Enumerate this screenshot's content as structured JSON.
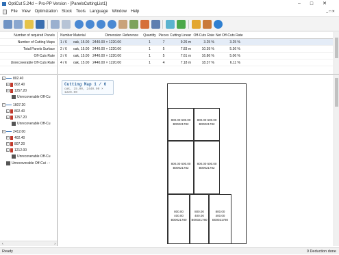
{
  "window": {
    "title": "OptiCut 5.24d -- Pro-PP Version - [PanelsCuttingList1]",
    "buttons": [
      "–",
      "□",
      "✕"
    ]
  },
  "menu": {
    "items": [
      "File",
      "View",
      "Optimization",
      "Stock",
      "Tools",
      "Language",
      "Window",
      "Help"
    ],
    "mdi_controls": "_ □ ✕"
  },
  "toolbar": {
    "icons": [
      "grid-icon",
      "list-icon",
      "new-icon",
      "save-icon",
      "calc-icon",
      "clear-icon",
      "zoom-in-icon",
      "zoom-out-icon",
      "zoom-fit-icon",
      "zoom-reset-icon",
      "hand-icon",
      "table-icon",
      "cut-icon",
      "settings-icon",
      "stock-icon",
      "export-icon",
      "shape-icon",
      "print-icon",
      "info-icon"
    ]
  },
  "summary": {
    "labels": [
      "Number of required Panels",
      "Number of Cutting Maps",
      "Total Panels Surface",
      "Off-Cuts Rate",
      "Unrecoverable Off-Cuts Rate"
    ]
  },
  "cutting_table": {
    "headers": [
      "Number",
      "Material",
      "Dimension",
      "Reference",
      "Quantity",
      "Pieces",
      "Cutting Linear",
      "Off-Cuts Rate",
      "Net Off-Cuts Rate"
    ],
    "rows": [
      [
        "1 / 6",
        "oak, 15.00",
        "2440.00 × 1220.00",
        "",
        "1",
        "7",
        "9.26 m",
        "3.25 %",
        "3.25 %"
      ],
      [
        "2 / 6",
        "oak, 15.00",
        "2440.00 × 1220.00",
        "",
        "1",
        "5",
        "7.83 m",
        "10.39 %",
        "5.36 %"
      ],
      [
        "3 / 6",
        "oak, 15.00",
        "2440.00 × 1220.00",
        "",
        "1",
        "5",
        "7.61 m",
        "16.86 %",
        "5.06 %"
      ],
      [
        "4 / 6",
        "oak, 15.00",
        "2440.00 × 1220.00",
        "",
        "1",
        "4",
        "7.18 m",
        "18.37 %",
        "6.11 %"
      ]
    ]
  },
  "tree": {
    "nodes": [
      {
        "label": "802.40",
        "level": 0,
        "kind": "group"
      },
      {
        "label": "802.40",
        "level": 1,
        "kind": "panel"
      },
      {
        "label": "1257.20",
        "level": 1,
        "kind": "panel"
      },
      {
        "label": "Unrecoverable Off-Cu",
        "level": 1,
        "kind": "offcut"
      },
      {
        "label": "1607.20",
        "level": 0,
        "kind": "group"
      },
      {
        "label": "802.40",
        "level": 1,
        "kind": "panel"
      },
      {
        "label": "1257.20",
        "level": 1,
        "kind": "panel"
      },
      {
        "label": "Unrecoverable Off-Cu",
        "level": 1,
        "kind": "offcut"
      },
      {
        "label": "2412.00",
        "level": 0,
        "kind": "group"
      },
      {
        "label": "402.40",
        "level": 1,
        "kind": "panel"
      },
      {
        "label": "807.20",
        "level": 1,
        "kind": "panel"
      },
      {
        "label": "1212.00",
        "level": 1,
        "kind": "panel"
      },
      {
        "label": "Unrecoverable Off-Cu",
        "level": 1,
        "kind": "offcut"
      },
      {
        "label": "Unrecoverable Off-Cut - :",
        "level": 0,
        "kind": "offcut"
      }
    ]
  },
  "map": {
    "title": "Cutting Map 1 / 6",
    "subtitle": "oak, 15.00, 2440.00 × 1220.00",
    "panels": [
      {
        "dims": "800.00      600.00",
        "ref": "B00021782"
      },
      {
        "dims": "800.00      600.00",
        "ref": "B00021782"
      },
      {
        "dims": "800.00      600.00",
        "ref": "B00021782"
      },
      {
        "dims": "800.00      600.00",
        "ref": "B00021782"
      },
      {
        "dims": "800.00",
        "dims2": "400.00",
        "ref": "B00021780"
      },
      {
        "dims": "800.00",
        "dims2": "400.00",
        "ref": "B00021780"
      },
      {
        "dims": "800.00",
        "dims2": "400.00",
        "ref": "B00021780"
      }
    ]
  },
  "status": {
    "left": "Ready",
    "right": "0 Deduction done"
  },
  "colors": {
    "accent": "#2f6fb5",
    "tree_panel_marker": "#c0392b",
    "selection": "#e4ecf7"
  }
}
